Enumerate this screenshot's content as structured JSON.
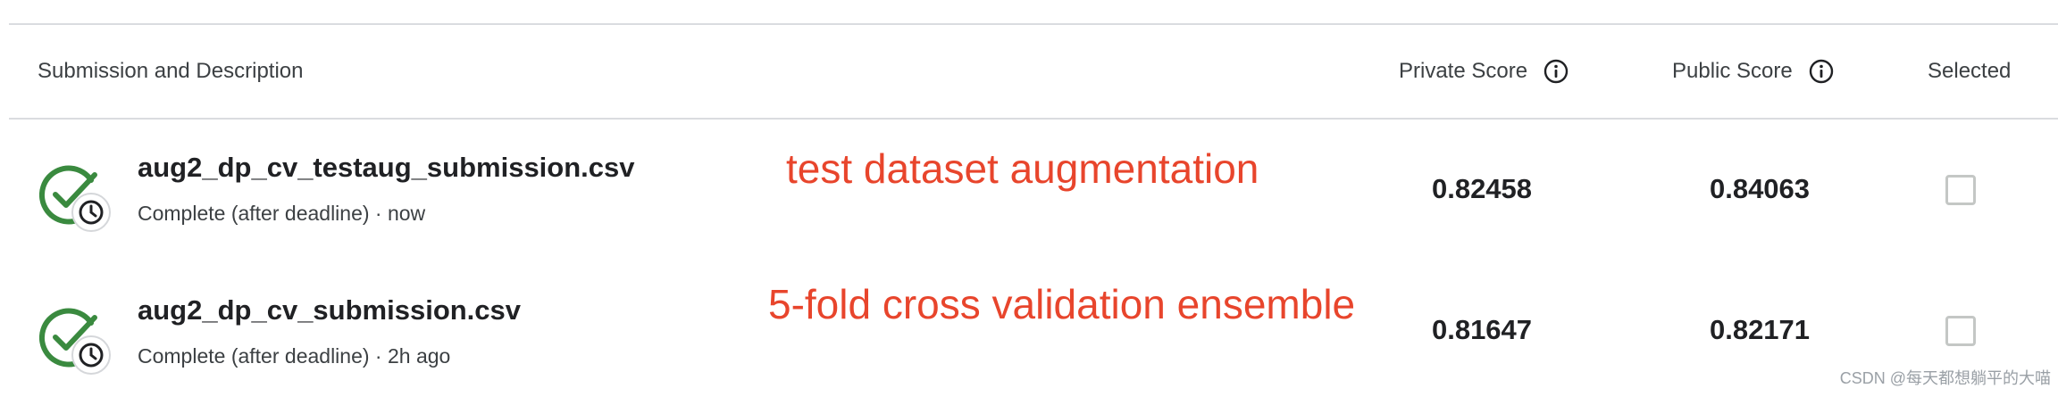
{
  "table": {
    "headers": {
      "submission": "Submission and Description",
      "private_score": "Private Score",
      "public_score": "Public Score",
      "selected": "Selected"
    },
    "rows": [
      {
        "file_name": "aug2_dp_cv_testaug_submission.csv",
        "status": "Complete (after deadline) · now",
        "annotation": "test dataset augmentation",
        "private_score": "0.82458",
        "public_score": "0.84063",
        "selected": false
      },
      {
        "file_name": "aug2_dp_cv_submission.csv",
        "status": "Complete (after deadline) · 2h ago",
        "annotation": "5-fold cross validation ensemble",
        "private_score": "0.81647",
        "public_score": "0.82171",
        "selected": false
      }
    ]
  },
  "watermark": "CSDN @每天都想躺平的大喵",
  "colors": {
    "success_green": "#3a8a3f",
    "annotation_red": "#e8452c",
    "divider": "#dadce0"
  },
  "icons": {
    "status": "check-clock-icon",
    "info": "info-icon",
    "checkbox": "checkbox-unchecked"
  }
}
